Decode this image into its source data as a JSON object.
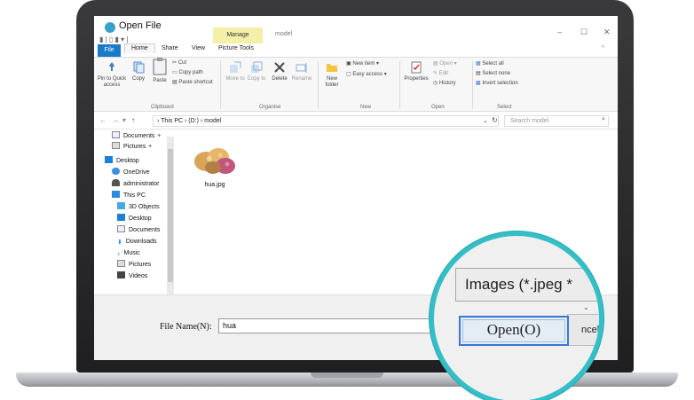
{
  "window": {
    "title": "Open File",
    "context_tab": "Manage",
    "context_subtitle": "model",
    "controls": {
      "minimize": "–",
      "maximize": "☐",
      "close": "✕"
    }
  },
  "ribbon": {
    "tabs": [
      {
        "label": "File"
      },
      {
        "label": "Home"
      },
      {
        "label": "Share"
      },
      {
        "label": "View"
      },
      {
        "label": "Picture Tools"
      }
    ],
    "clipboard": {
      "group_label": "Clipboard",
      "pin": "Pin to Quick access",
      "copy": "Copy",
      "paste": "Paste",
      "cut": "Cut",
      "copy_path": "Copy path",
      "paste_shortcut": "Paste shortcut"
    },
    "organise": {
      "group_label": "Organise",
      "move_to": "Move to",
      "copy_to": "Copy to",
      "delete": "Delete",
      "rename": "Rename"
    },
    "new": {
      "group_label": "New",
      "new_folder": "New folder",
      "new_item": "New item ▾",
      "easy_access": "Easy access ▾"
    },
    "open": {
      "group_label": "Open",
      "properties": "Properties",
      "open": "Open ▾",
      "edit": "Edit",
      "history": "History"
    },
    "select": {
      "group_label": "Select",
      "select_all": "Select all",
      "select_none": "Select none",
      "invert": "Invert selection"
    }
  },
  "address": {
    "path": "›  This PC  ›  (D:)  ›  model",
    "search_placeholder": "Search model"
  },
  "navpane": {
    "items": [
      {
        "label": "Documents"
      },
      {
        "label": "Pictures"
      },
      {
        "label": "Desktop"
      },
      {
        "label": "OneDrive"
      },
      {
        "label": "administrator"
      },
      {
        "label": "This PC"
      },
      {
        "label": "3D Objects"
      },
      {
        "label": "Desktop"
      },
      {
        "label": "Documents"
      },
      {
        "label": "Downloads"
      },
      {
        "label": "Music"
      },
      {
        "label": "Pictures"
      },
      {
        "label": "Videos"
      }
    ]
  },
  "files": [
    {
      "name": "hua.jpg"
    }
  ],
  "dialog": {
    "file_name_label": "File Name(N):",
    "file_name_value": "hua",
    "filter": "Images (*.jpeg *",
    "open_button": "Open(O)",
    "cancel_button": "ncel"
  },
  "colors": {
    "accent": "#1979ca",
    "lens_ring": "#34bfc7",
    "manage_tab": "#f4f0a8"
  }
}
